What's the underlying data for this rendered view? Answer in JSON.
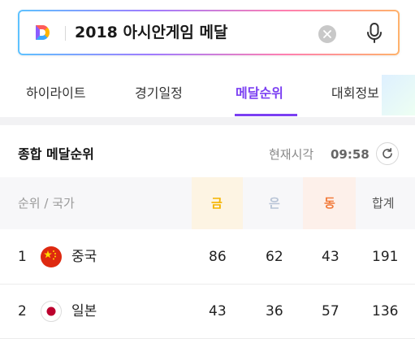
{
  "search": {
    "query": "2018 아시안게임 메달",
    "logo_icon": "daum-logo-icon",
    "clear_icon": "clear-icon",
    "mic_icon": "microphone-icon"
  },
  "tabs": [
    {
      "label": "하이라이트",
      "active": false
    },
    {
      "label": "경기일정",
      "active": false
    },
    {
      "label": "메달순위",
      "active": true
    },
    {
      "label": "대회정보",
      "active": false
    }
  ],
  "section": {
    "title": "종합 메달순위",
    "now_label": "현재시각",
    "now_time": "09:58",
    "refresh_icon": "refresh-icon"
  },
  "table": {
    "headers": {
      "rank_country": "순위 / 국가",
      "gold": "금",
      "silver": "은",
      "bronze": "동",
      "total": "합계"
    },
    "rows": [
      {
        "rank": "1",
        "country": "중국",
        "flag": "china-flag-icon",
        "gold": "86",
        "silver": "62",
        "bronze": "43",
        "total": "191"
      },
      {
        "rank": "2",
        "country": "일본",
        "flag": "japan-flag-icon",
        "gold": "43",
        "silver": "36",
        "bronze": "57",
        "total": "136"
      }
    ]
  },
  "colors": {
    "accent": "#7b3ff2",
    "gold": "#f5b400",
    "silver": "#b8c4d6",
    "bronze": "#f27a3a"
  }
}
